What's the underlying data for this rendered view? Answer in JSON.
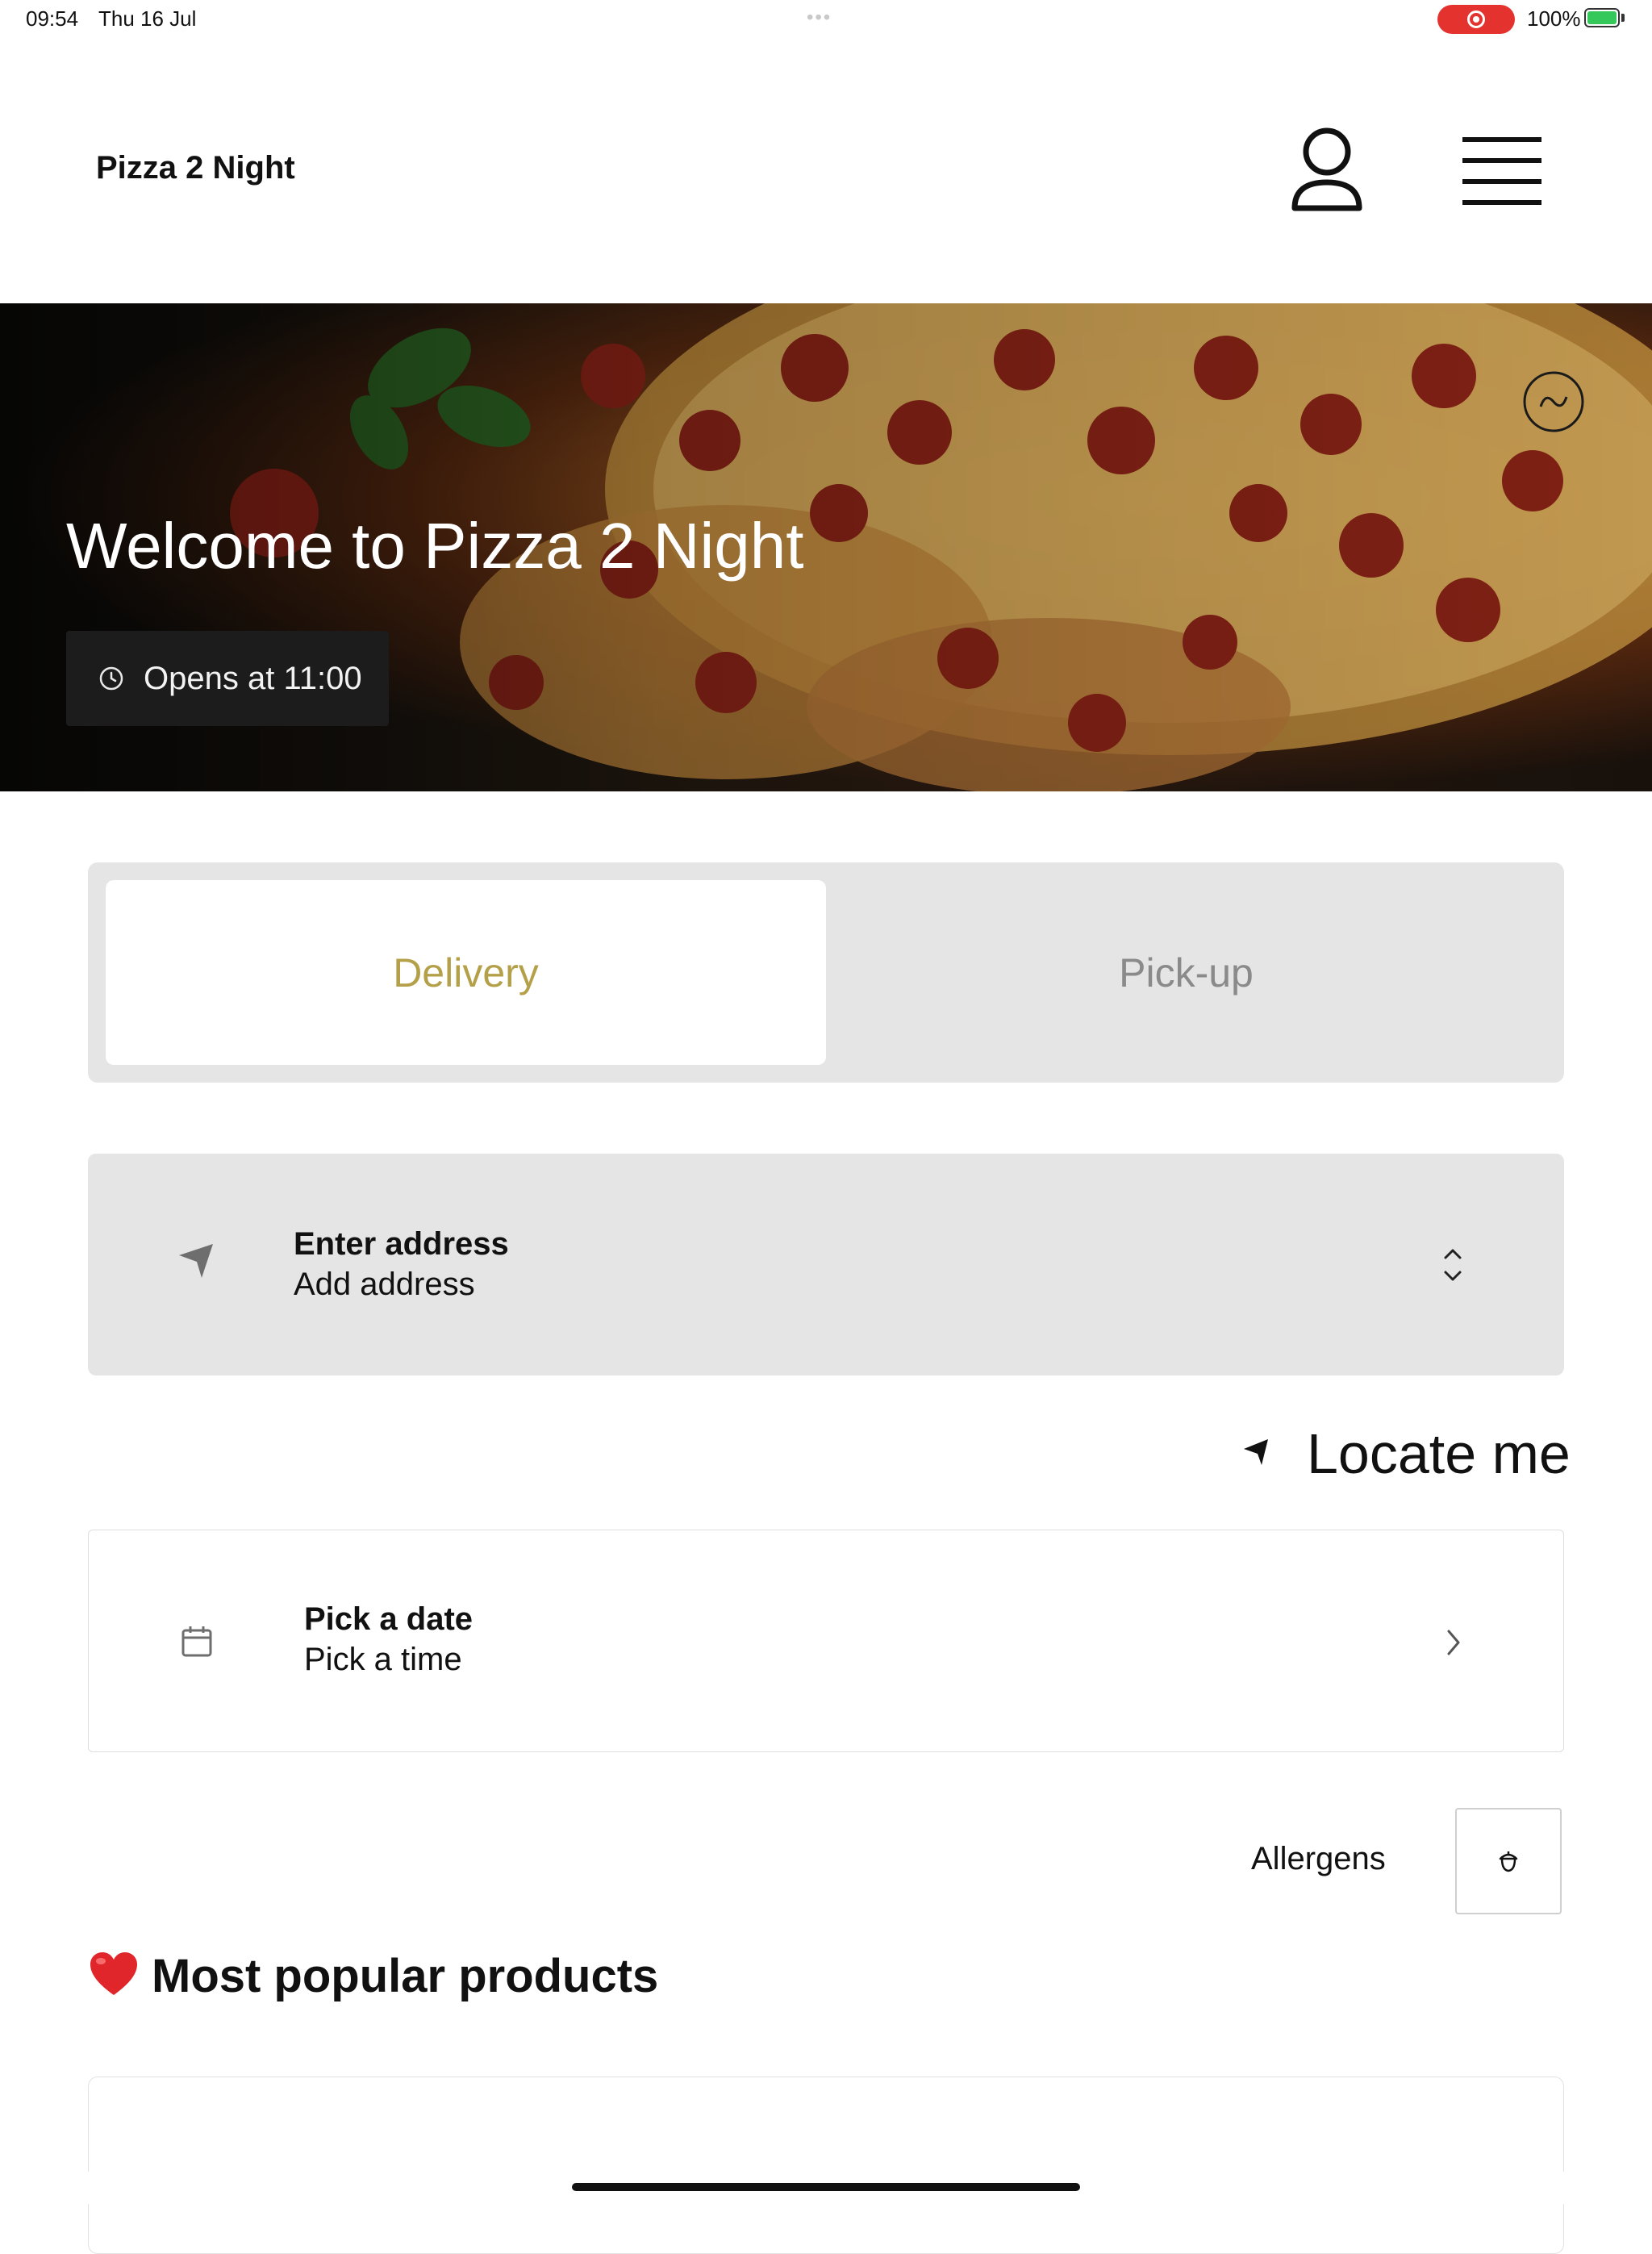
{
  "status_bar": {
    "time": "09:54",
    "date": "Thu 16 Jul",
    "battery": "100%"
  },
  "header": {
    "brand": "Pizza 2 Night",
    "icons": [
      "user-icon",
      "menu-icon"
    ]
  },
  "hero": {
    "title": "Welcome to Pizza 2 Night",
    "hours": "Opens at 11:00"
  },
  "order_mode": {
    "tabs": [
      {
        "label": "Delivery",
        "selected": true
      },
      {
        "label": "Pick-up",
        "selected": false
      }
    ]
  },
  "address": {
    "title": "Enter address",
    "subtitle": "Add address"
  },
  "locate": {
    "label": "Locate me"
  },
  "schedule": {
    "title": "Pick a date",
    "subtitle": "Pick a time"
  },
  "allergens": {
    "label": "Allergens"
  },
  "popular": {
    "title": "Most popular products"
  },
  "colors": {
    "accent": "#b5a04a",
    "panel": "#e5e5e5",
    "recording": "#e4332f",
    "battery": "#34c759"
  }
}
